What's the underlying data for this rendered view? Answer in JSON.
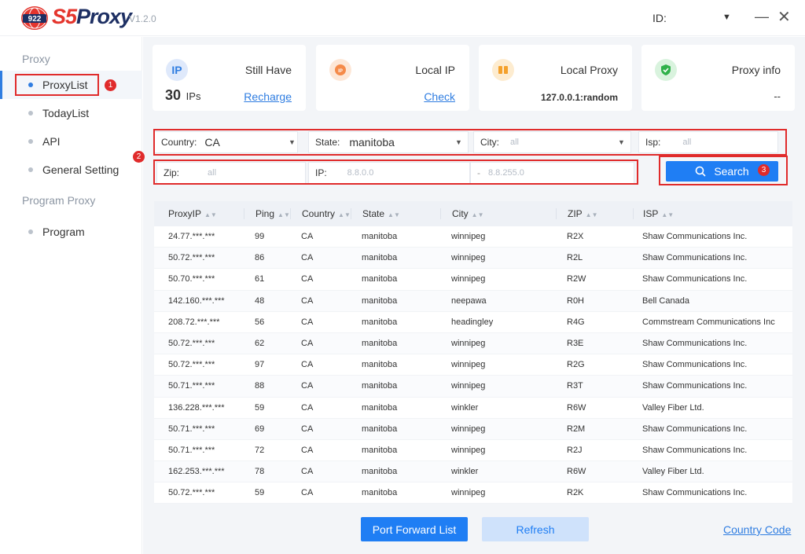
{
  "app": {
    "title": "S5Proxy",
    "badge": "922",
    "version": "V1.2.0"
  },
  "header": {
    "id_label": "ID:"
  },
  "sidebar": {
    "groups": [
      {
        "label": "Proxy",
        "items": [
          "ProxyList",
          "TodayList",
          "API",
          "General Setting"
        ]
      },
      {
        "label": "Program Proxy",
        "items": [
          "Program"
        ]
      }
    ]
  },
  "annotations": [
    "1",
    "2",
    "3"
  ],
  "cards": {
    "ips": {
      "icon": "IP",
      "title": "Still Have",
      "count": "30",
      "unit": "IPs",
      "link": "Recharge"
    },
    "local_ip": {
      "title": "Local IP",
      "link": "Check"
    },
    "local_proxy": {
      "title": "Local Proxy",
      "value": "127.0.0.1:random"
    },
    "proxy_info": {
      "title": "Proxy info",
      "value": "--"
    }
  },
  "filters": {
    "country": {
      "label": "Country:",
      "value": "CA"
    },
    "state": {
      "label": "State:",
      "value": "manitoba"
    },
    "city": {
      "label": "City:",
      "placeholder": "all"
    },
    "isp": {
      "label": "Isp:",
      "placeholder": "all"
    },
    "zip": {
      "label": "Zip:",
      "placeholder": "all"
    },
    "ip": {
      "label": "IP:",
      "from": "8.8.0.0",
      "sep": "-",
      "to": "8.8.255.0"
    },
    "search_label": "Search"
  },
  "table": {
    "columns": [
      "ProxyIP",
      "Ping",
      "Country",
      "State",
      "City",
      "ZIP",
      "ISP"
    ],
    "rows": [
      [
        "24.77.***.***",
        "99",
        "CA",
        "manitoba",
        "winnipeg",
        "R2X",
        "Shaw Communications Inc."
      ],
      [
        "50.72.***.***",
        "86",
        "CA",
        "manitoba",
        "winnipeg",
        "R2L",
        "Shaw Communications Inc."
      ],
      [
        "50.70.***.***",
        "61",
        "CA",
        "manitoba",
        "winnipeg",
        "R2W",
        "Shaw Communications Inc."
      ],
      [
        "142.160.***.***",
        "48",
        "CA",
        "manitoba",
        "neepawa",
        "R0H",
        "Bell Canada"
      ],
      [
        "208.72.***.***",
        "56",
        "CA",
        "manitoba",
        "headingley",
        "R4G",
        "Commstream Communications Inc"
      ],
      [
        "50.72.***.***",
        "62",
        "CA",
        "manitoba",
        "winnipeg",
        "R3E",
        "Shaw Communications Inc."
      ],
      [
        "50.72.***.***",
        "97",
        "CA",
        "manitoba",
        "winnipeg",
        "R2G",
        "Shaw Communications Inc."
      ],
      [
        "50.71.***.***",
        "88",
        "CA",
        "manitoba",
        "winnipeg",
        "R3T",
        "Shaw Communications Inc."
      ],
      [
        "136.228.***.***",
        "59",
        "CA",
        "manitoba",
        "winkler",
        "R6W",
        "Valley Fiber Ltd."
      ],
      [
        "50.71.***.***",
        "69",
        "CA",
        "manitoba",
        "winnipeg",
        "R2M",
        "Shaw Communications Inc."
      ],
      [
        "50.71.***.***",
        "72",
        "CA",
        "manitoba",
        "winnipeg",
        "R2J",
        "Shaw Communications Inc."
      ],
      [
        "162.253.***.***",
        "78",
        "CA",
        "manitoba",
        "winkler",
        "R6W",
        "Valley Fiber Ltd."
      ],
      [
        "50.72.***.***",
        "59",
        "CA",
        "manitoba",
        "winnipeg",
        "R2K",
        "Shaw Communications Inc."
      ]
    ]
  },
  "footer": {
    "port_forward": "Port Forward List",
    "refresh": "Refresh",
    "country_code": "Country Code"
  },
  "colors": {
    "accent": "#1f7ef4",
    "annotation": "#e02b2b",
    "brand_red": "#e4352d",
    "brand_navy": "#1d2f63"
  }
}
